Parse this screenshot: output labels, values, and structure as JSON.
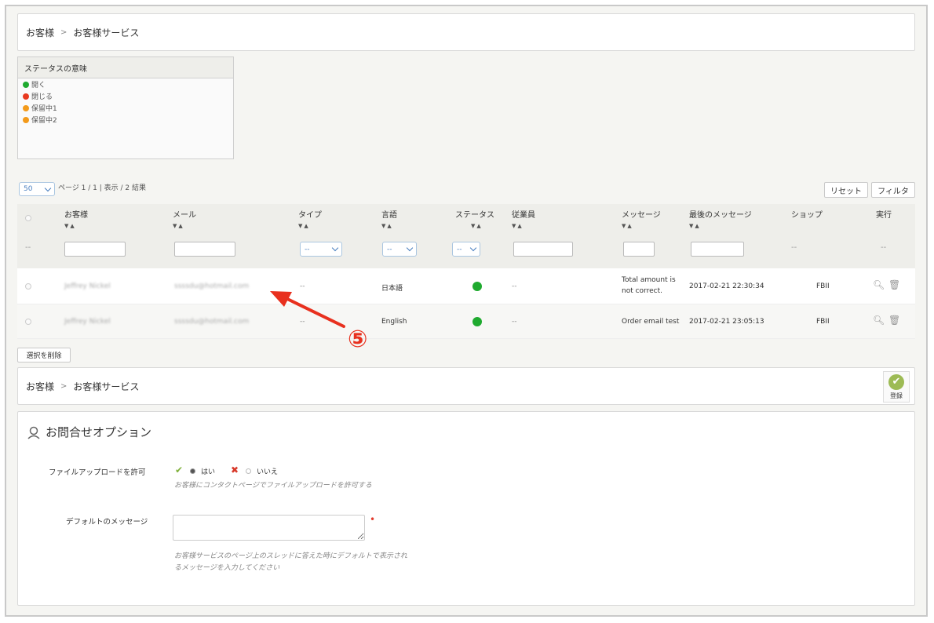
{
  "breadcrumb": {
    "root": "お客様",
    "sep": ">",
    "current": "お客様サービス"
  },
  "status_legend": {
    "title": "ステータスの意味",
    "items": [
      {
        "label": "開く",
        "color": "#1faa2f"
      },
      {
        "label": "閉じる",
        "color": "#e8391f"
      },
      {
        "label": "保留中1",
        "color": "#f39a1a"
      },
      {
        "label": "保留中2",
        "color": "#f39a1a"
      }
    ]
  },
  "pagination": {
    "per_page": "50",
    "info": "ページ 1 / 1 | 表示 / 2 結果"
  },
  "toolbar": {
    "reset_label": "リセット",
    "filter_label": "フィルタ"
  },
  "table": {
    "columns": [
      "お客様",
      "メール",
      "タイプ",
      "言語",
      "ステータス",
      "従業員",
      "メッセージ",
      "最後のメッセージ",
      "ショップ",
      "実行"
    ],
    "sort_glyph": "▼▲",
    "filter_dash": "--",
    "rows": [
      {
        "customer": "Jeffrey Nickel",
        "email": "ssssdu@hotmail.com",
        "type": "--",
        "language": "日本語",
        "status_color": "#1faa2f",
        "employee": "--",
        "message": "Total amount is not correct.",
        "last_message": "2017-02-21 22:30:34",
        "shop": "FBII"
      },
      {
        "customer": "Jeffrey Nickel",
        "email": "ssssdu@hotmail.com",
        "type": "--",
        "language": "English",
        "status_color": "#1faa2f",
        "employee": "--",
        "message": "Order email test",
        "last_message": "2017-02-21 23:05:13",
        "shop": "FBII"
      }
    ]
  },
  "bulk_delete_label": "選択を削除",
  "save_label": "登録",
  "options": {
    "title": "お問合せオプション",
    "file_upload": {
      "label": "ファイルアップロードを許可",
      "yes": "はい",
      "no": "いいえ",
      "help": "お客様にコンタクトページでファイルアップロードを許可する"
    },
    "default_message": {
      "label": "デフォルトのメッセージ",
      "help_line1": "お客様サービスのページ上のスレッドに答えた時にデフォルトで表示され",
      "help_line2": "るメッセージを入力してください"
    }
  },
  "annotation": {
    "marker": "⑤",
    "color": "#e8301e"
  }
}
